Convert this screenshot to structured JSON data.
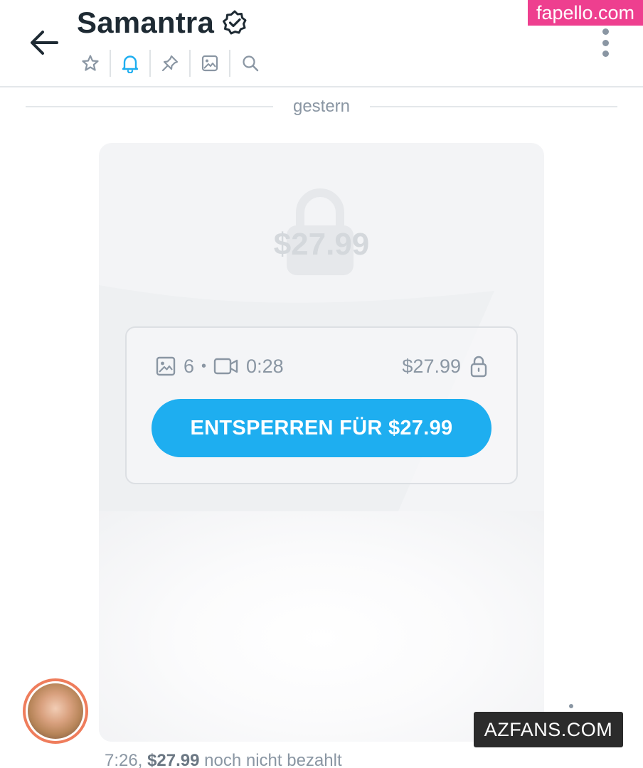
{
  "header": {
    "title": "Samantra",
    "verified": true,
    "icons": [
      "star-icon",
      "bell-icon",
      "pin-icon",
      "image-icon",
      "search-icon"
    ],
    "active_color": "#1eaef0"
  },
  "watermarks": {
    "top": "fapello.com",
    "bottom": "AZFANS.COM"
  },
  "date_separator": "gestern",
  "message": {
    "price_display": "$27.99",
    "media_count": "6",
    "dot": "•",
    "video_duration": "0:28",
    "card_price": "$27.99",
    "unlock_label": "ENTSPERREN FÜR $27.99",
    "time": "7:26,",
    "status_price": "$27.99",
    "status_text": "noch nicht bezahlt"
  },
  "colors": {
    "accent": "#1eaef0",
    "muted": "#8a96a3",
    "bubble": "#f3f4f6",
    "avatar_ring": "#ef7d5c"
  }
}
